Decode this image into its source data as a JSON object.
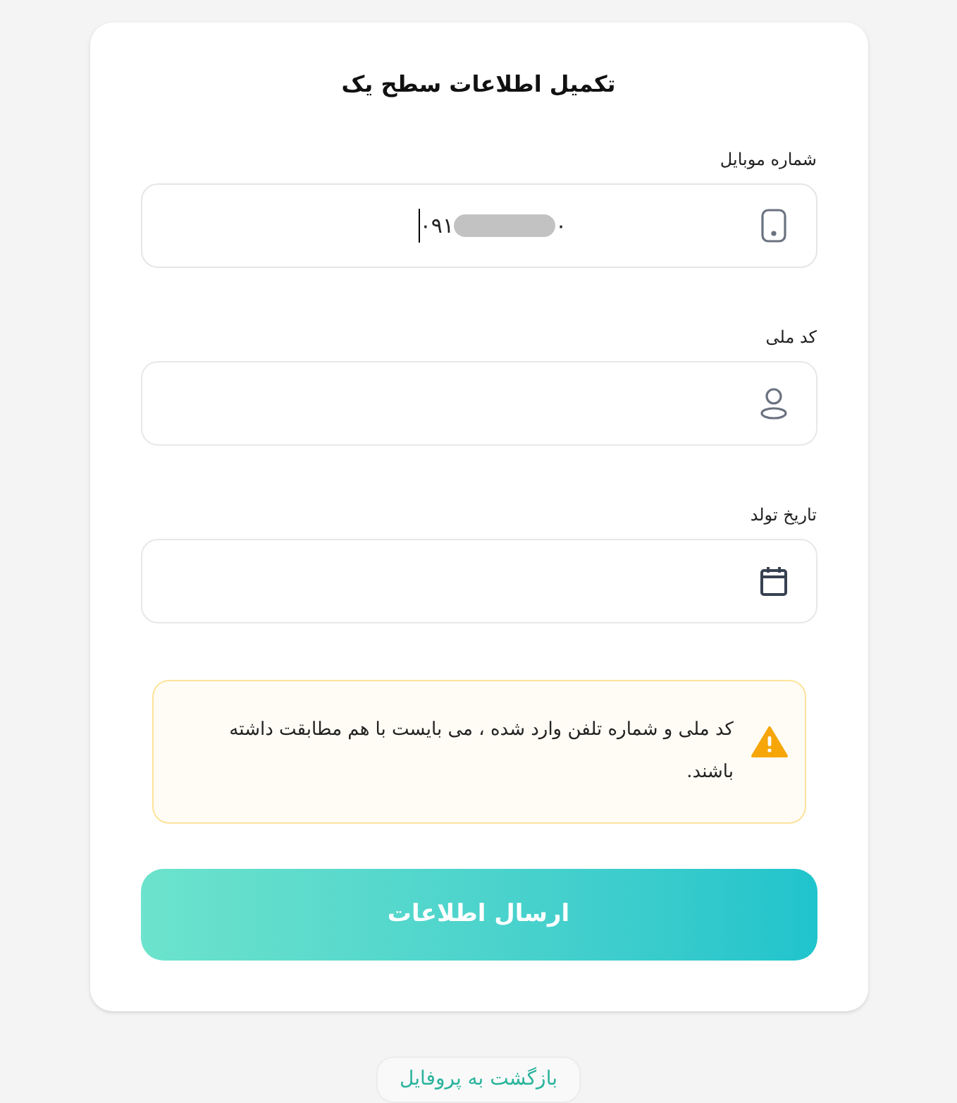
{
  "title": "تکمیل اطلاعات سطح یک",
  "fields": [
    {
      "kind": "phone",
      "label": "شماره موبایل",
      "value_start": "۰۹۱",
      "value_end": "۰",
      "redacted": true,
      "focused": true
    },
    {
      "kind": "person",
      "label": "کد ملی"
    },
    {
      "kind": "calendar",
      "label": "تاریخ تولد"
    }
  ],
  "warning": {
    "text": "کد ملی و شماره تلفن وارد شده ، می بایست با هم مطابقت داشته باشند."
  },
  "submit_button": "ارسال اطلاعات",
  "back_button": "بازگشت به پروفایل"
}
